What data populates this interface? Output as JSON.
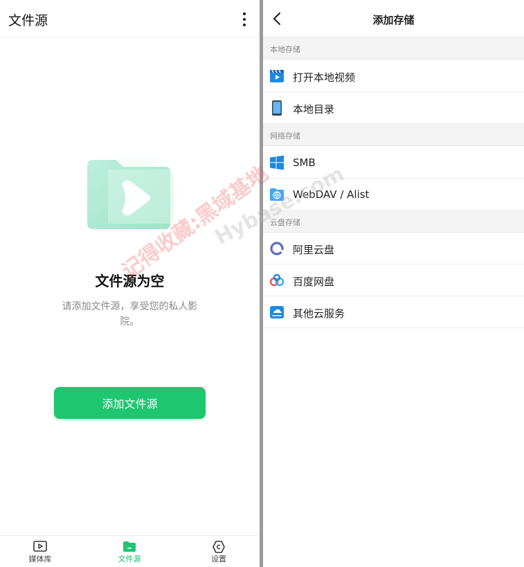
{
  "left": {
    "header_title": "文件源",
    "empty_title": "文件源为空",
    "empty_desc": "请添加文件源，享受您的私人影院。",
    "add_button": "添加文件源",
    "tabs": [
      {
        "label": "媒体库",
        "icon": "play-box-icon"
      },
      {
        "label": "文件源",
        "icon": "folder-icon"
      },
      {
        "label": "设置",
        "icon": "settings-hexagon-icon"
      }
    ],
    "accent_color": "#1fc670"
  },
  "right": {
    "header_title": "添加存储",
    "sections": [
      {
        "title": "本地存储",
        "items": [
          {
            "label": "打开本地视频",
            "icon": "clapperboard-icon"
          },
          {
            "label": "本地目录",
            "icon": "phone-icon"
          }
        ]
      },
      {
        "title": "网络存储",
        "items": [
          {
            "label": "SMB",
            "icon": "windows-icon"
          },
          {
            "label": "WebDAV / Alist",
            "icon": "globe-folder-icon"
          }
        ]
      },
      {
        "title": "云盘存储",
        "items": [
          {
            "label": "阿里云盘",
            "icon": "aliyun-icon"
          },
          {
            "label": "百度网盘",
            "icon": "baidu-icon"
          },
          {
            "label": "其他云服务",
            "icon": "cloud-drive-icon"
          }
        ]
      }
    ]
  },
  "watermark": {
    "text1": "记得收藏:黑域基地",
    "text2": "Hybase.com"
  }
}
